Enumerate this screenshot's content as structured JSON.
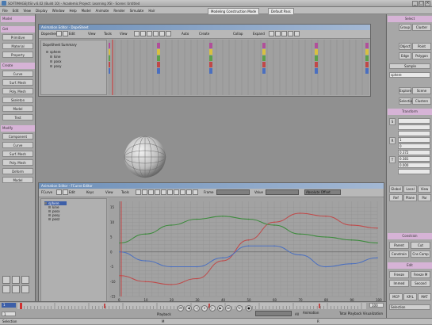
{
  "window": {
    "title": "SOFTIMAGE|XSI v.6.02 (Build 10) - Academic Project: Learning XSI - Scene: Untitled",
    "menu": [
      "File",
      "Edit",
      "View",
      "Display",
      "Window",
      "Help",
      "Model",
      "Animate",
      "Render",
      "Simulate",
      "Hair"
    ],
    "construction_mode": "Modeling Construction Mode",
    "selection_mode": "Default Pass"
  },
  "left_toolbar": {
    "sections": [
      {
        "label": "Model",
        "buttons": []
      },
      {
        "label": "Get",
        "buttons": [
          "Primitive",
          "Material",
          "Property"
        ]
      },
      {
        "label": "Create",
        "buttons": [
          "Curve",
          "Surf. Mesh",
          "Poly. Mesh",
          "Skeleton",
          "Model",
          "Text"
        ]
      },
      {
        "label": "Modify",
        "buttons": [
          "Component",
          "Curve",
          "Surf. Mesh",
          "Poly. Mesh",
          "Deform",
          "Model"
        ]
      }
    ]
  },
  "dopesheet": {
    "title": "Animation Editor - DopeSheet",
    "menus": [
      "Dopesheet",
      "Edit",
      "View",
      "Tools",
      "View"
    ],
    "summary_label": "DopeSheet Summary",
    "tracks": [
      "sphere",
      "kine",
      "posx",
      "posy"
    ],
    "buttons": [
      "Auto",
      "Create",
      "Collap",
      "Expand"
    ]
  },
  "curve_editor": {
    "title": "Animation Editor - FCurve Editor",
    "menus": [
      "FCurve",
      "Edit",
      "Keys",
      "View",
      "Tools"
    ],
    "tree": [
      "sphere",
      "kine",
      "posx",
      "posy",
      "posz"
    ],
    "fields": {
      "frame_label": "Frame",
      "value_label": "Value",
      "mode": "Absolute Offset"
    },
    "y_ticks": [
      "15",
      "10",
      "5",
      "0",
      "-5",
      "-10",
      "-15"
    ],
    "x_ticks": [
      "0",
      "10",
      "20",
      "30",
      "40",
      "50",
      "60",
      "70",
      "80",
      "90",
      "100"
    ]
  },
  "chart_data": {
    "type": "line",
    "x": [
      0,
      10,
      20,
      30,
      40,
      50,
      60,
      70,
      80,
      90,
      100
    ],
    "ylim": [
      -15,
      17
    ],
    "xlim": [
      0,
      100
    ],
    "grid": true,
    "series": [
      {
        "color": "#c04848",
        "values": [
          -8,
          -10,
          -11,
          -9,
          -3,
          4,
          10,
          13,
          12,
          9,
          8
        ]
      },
      {
        "color": "#3a8a3a",
        "values": [
          3,
          6,
          9,
          11,
          12,
          11,
          9,
          6,
          5,
          4,
          3
        ]
      },
      {
        "color": "#4a6fc0",
        "values": [
          0,
          -3,
          -5,
          -5,
          -2,
          2,
          2,
          -1,
          -5,
          -4,
          -2
        ]
      }
    ]
  },
  "timeline": {
    "start": "1",
    "end": "100",
    "current": "1",
    "playback_label": "Playback",
    "all_label": "All",
    "anim_label": "Animation",
    "ticks": [
      "1",
      "10",
      "20",
      "30",
      "40",
      "50",
      "60",
      "70",
      "80",
      "90",
      "100"
    ]
  },
  "right_panel": {
    "select_header": "Select",
    "buttons1": [
      "Group",
      "Cluster"
    ],
    "buttons2": [
      "Object",
      "Point"
    ],
    "buttons3": [
      "Edge",
      "Polygon"
    ],
    "sample_label": "Sample",
    "name_field": "sphere",
    "buttons4": [
      "Explore",
      "Scene"
    ],
    "buttons5": [
      "Selection",
      "Clusters"
    ],
    "transform_header": "Transform",
    "srt_labels": [
      "S",
      "R",
      "T"
    ],
    "values": [
      "1",
      "0",
      "0.372",
      "0.381",
      "0.000"
    ],
    "ref_buttons": [
      "Global",
      "Local",
      "View",
      "Ref",
      "Plane",
      "Par"
    ],
    "constrain_header": "Constrain",
    "constrain_buttons": [
      "Parent",
      "Cut",
      "Constrain",
      "Cns Comp"
    ],
    "edit_header": "Edit",
    "edit_buttons": [
      "Freeze",
      "Freeze M",
      "Immed",
      "Second"
    ],
    "bottom_buttons": [
      "MCP",
      "KP/L",
      "MAT"
    ],
    "status": "Selection"
  },
  "status_bar": {
    "text": "Selection",
    "m": "M",
    "r": "R"
  },
  "tree_extra": "Total Playback Visualization"
}
